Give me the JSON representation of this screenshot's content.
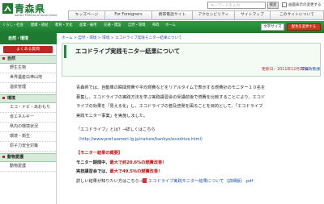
{
  "header": {
    "logo_title": "青森県",
    "logo_sub": "Aomori Prefectural Government",
    "search_placeholder": "キーワードを入力",
    "search_button": "検索",
    "checkbox_label": "画面表示の変更する",
    "nav": [
      "キッズページ",
      "For Foreigners",
      "携帯電話サイト",
      "アクセシビリティ",
      "サイトマップ",
      "このサイトについて"
    ]
  },
  "subnav": {
    "items": [
      "くらし・社会",
      "健康・福祉",
      "教育・文化",
      "産業・雇用",
      "交通・建設",
      "自然・環境",
      "県政",
      "ホーム"
    ],
    "font_size_label": "文字サイズ",
    "tone_label": "配色を変更する"
  },
  "sidebar": {
    "head": "自然・環境",
    "faq": "よくある質問",
    "sections": [
      {
        "title": "自然",
        "items": [
          "野生生物",
          "世界遺産白神山地",
          "温泉管理"
        ]
      },
      {
        "title": "環境",
        "items": [
          "エコ・ナビ・あおもり",
          "省エネルギー",
          "県内の環境状況",
          "環境・衛生",
          "原子力安全対策"
        ]
      },
      {
        "title": "動物愛護",
        "items": [
          "動物愛護"
        ]
      }
    ]
  },
  "main": {
    "breadcrumb": "ホーム > 自然・環境 > 環境 > エコドライブ実践モニター結果について",
    "title": "エコドライブ実践モニター結果について",
    "updated": "更新日：2011年12月27日",
    "dept": "環境政策課",
    "paragraph_lines": [
      "青森県では、自動車の瞬間燃費や平均燃費などをリアルタイムで表示する燃費計のモニター１０名を",
      "募集し、エコドライブの実践方法を学ぶ実践講習会の受講前後で燃費を比較することにより、エコド",
      "ライブの効果を「見える化」し、エコドライブの普及啓発を図ることを目的として、「エコドライブ",
      "実践モニター事業」を実施しました。"
    ],
    "eco_question": "「エコドライブ」とは？→詳しくはこちら",
    "eco_url": "（http://www.pref.aomori.lg.jp/nature/kankyo/ecodrive.html）",
    "summary_heading": "【モニター結果の概要】",
    "summary_1_prefix": "モニター期間中、",
    "summary_1_red": "最大で約20.6%の燃費改善！",
    "summary_2_prefix": "実技講習会では、",
    "summary_2_red": "最大で49.5％の燃費改善！",
    "details_prefix": "詳しい結果が知りたい方はこちら→",
    "details_link": "エコドライブ実践モニター結果について（詳細版）.pdf"
  },
  "colors": {
    "brand_green": "#1d7a30",
    "accent_red": "#c02626",
    "link_blue": "#1a55a8"
  }
}
